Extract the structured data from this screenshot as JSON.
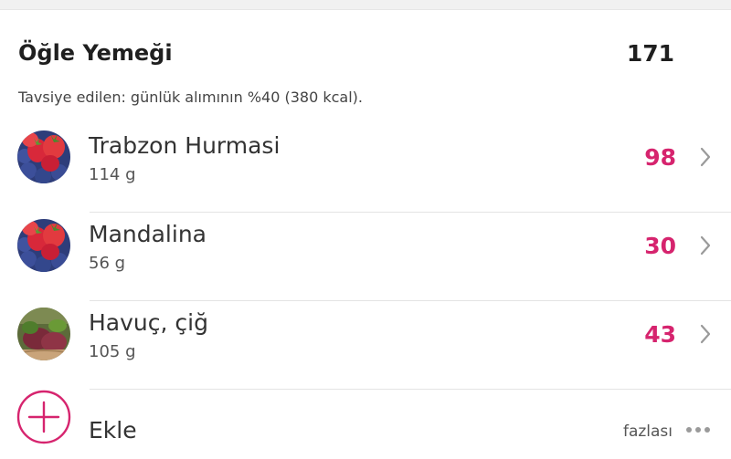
{
  "meal": {
    "title": "Öğle Yemeği",
    "total_kcal": "171",
    "recommendation": "Tavsiye edilen: günlük alımının %40 (380 kcal)."
  },
  "items": [
    {
      "name": "Trabzon Hurmasi",
      "amount": "114 g",
      "kcal": "98",
      "image": "berries-photo"
    },
    {
      "name": "Mandalina",
      "amount": "56 g",
      "kcal": "30",
      "image": "berries-photo"
    },
    {
      "name": "Havuç, çiğ",
      "amount": "105 g",
      "kcal": "43",
      "image": "vegetables-photo"
    }
  ],
  "footer": {
    "add_label": "Ekle",
    "more_label": "fazlası"
  },
  "colors": {
    "accent": "#d6246e",
    "text": "#222222",
    "muted": "#555555",
    "chevron": "#9a9a9a",
    "divider": "#e4e4e4"
  }
}
